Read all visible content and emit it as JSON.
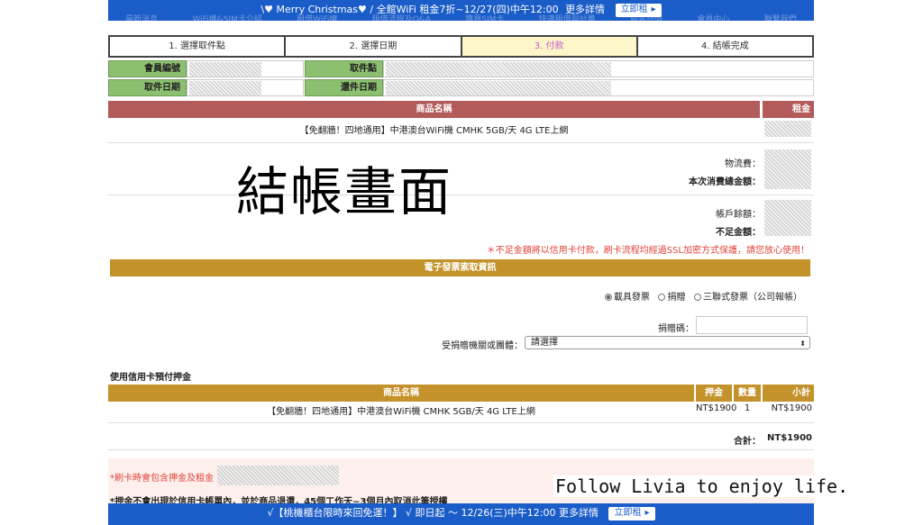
{
  "topbar": {
    "nav_items": [
      "最新消息",
      "WiFi機&SIM卡介紹",
      "租借WiFi機",
      "租借流程及Q&A",
      "購買SIM卡",
      "快速租借與計算",
      "顧客評價",
      "會員中心",
      "聯繫我們"
    ],
    "promo_text": "\\♥ Merry Christmas♥ / 全館WiFi 租金7折~12/27(四)中午12:00",
    "more_label": "更多詳情",
    "rent_label": "立即租",
    "arrow": "▸"
  },
  "steps": [
    {
      "label": "1. 選擇取件點",
      "active": false
    },
    {
      "label": "2. 選擇日期",
      "active": false
    },
    {
      "label": "3. 付款",
      "active": true
    },
    {
      "label": "4. 結帳完成",
      "active": false
    }
  ],
  "info": {
    "member_id_label": "會員編號",
    "pickup_point_label": "取件點",
    "pickup_date_label": "取件日期",
    "return_date_label": "還件日期"
  },
  "product_table": {
    "header_name": "商品名稱",
    "header_rent": "租金",
    "product": "【免翻牆！四地通用】中港澳台WiFi機 CMHK 5GB/天 4G LTE上網",
    "shipping_label": "物流費：",
    "total_label": "本次消費總金額：",
    "balance_label": "帳戶餘額：",
    "shortfall_label": "不足金額：",
    "notice": "＊不足金額將以信用卡付款，刷卡流程均經過SSL加密方式保護，請您放心使用！"
  },
  "watermark": "結帳畫面",
  "invoice": {
    "header": "電子發票索取資訊",
    "options": [
      {
        "label": "載具發票",
        "selected": true
      },
      {
        "label": "捐贈",
        "selected": false
      },
      {
        "label": "三聯式發票（公司報帳）",
        "selected": false
      }
    ],
    "donation_code_label": "捐贈碼：",
    "donation_org_label": "受捐贈機關或團體：",
    "select_value": "請選擇",
    "select_caret": "⬍"
  },
  "deposit": {
    "title": "使用信用卡預付押金",
    "headers": {
      "name": "商品名稱",
      "deposit": "押金",
      "qty": "數量",
      "subtotal": "小計"
    },
    "row": {
      "name": "【免翻牆！四地通用】中港澳台WiFi機 CMHK 5GB/天 4G LTE上網",
      "deposit": "NT$1900",
      "qty": "1",
      "subtotal": "NT$1900"
    },
    "total_label": "合計：",
    "total_value": "NT$1900"
  },
  "notes": {
    "note1": "*刷卡時會包含押金及租金",
    "note2": "*押金不會出現於信用卡帳單內，並於商品退還，45個工作天~3個月內取消此筆授權"
  },
  "follow_text": "Follow Livia to enjoy life.",
  "botbar": {
    "text": "√【桃機櫃台限時來回免運！】 √ 即日起 ～ 12/26(三)中午12:00",
    "more_label": "更多詳情",
    "rent_label": "立即租",
    "arrow": "▸"
  }
}
